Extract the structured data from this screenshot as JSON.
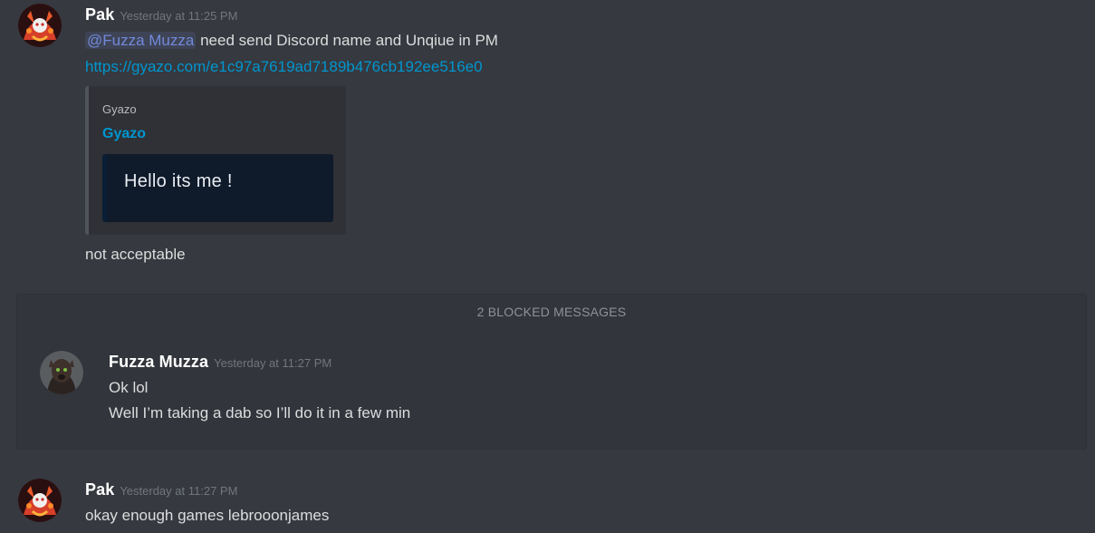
{
  "messages": [
    {
      "username": "Pak",
      "timestamp": "Yesterday at 11:25 PM",
      "mention": "@Fuzza Muzza",
      "line1_rest": " need send Discord name and Unqiue in PM",
      "link": "https://gyazo.com/e1c97a7619ad7189b476cb192ee516e0",
      "embed": {
        "provider": "Gyazo",
        "title": "Gyazo",
        "image_text": "Hello its me !"
      },
      "line3": "not acceptable"
    },
    {
      "username": "Pak",
      "timestamp": "Yesterday at 11:27 PM",
      "line1": "okay enough games lebrooonjames"
    }
  ],
  "blocked": {
    "label": "2 BLOCKED MESSAGES",
    "username": "Fuzza Muzza",
    "timestamp": "Yesterday at 11:27 PM",
    "lines": [
      "Ok lol",
      "Well I’m taking a dab so I’ll do it in a few min"
    ]
  },
  "colors": {
    "background": "#36393f",
    "mention": "#7289da",
    "link": "#0096cf",
    "username": "#ffffff",
    "timestamp": "#72767d"
  },
  "icons": {
    "pak_avatar": "pak-avatar-image",
    "fuzza_avatar": "fuzza-avatar-image"
  }
}
